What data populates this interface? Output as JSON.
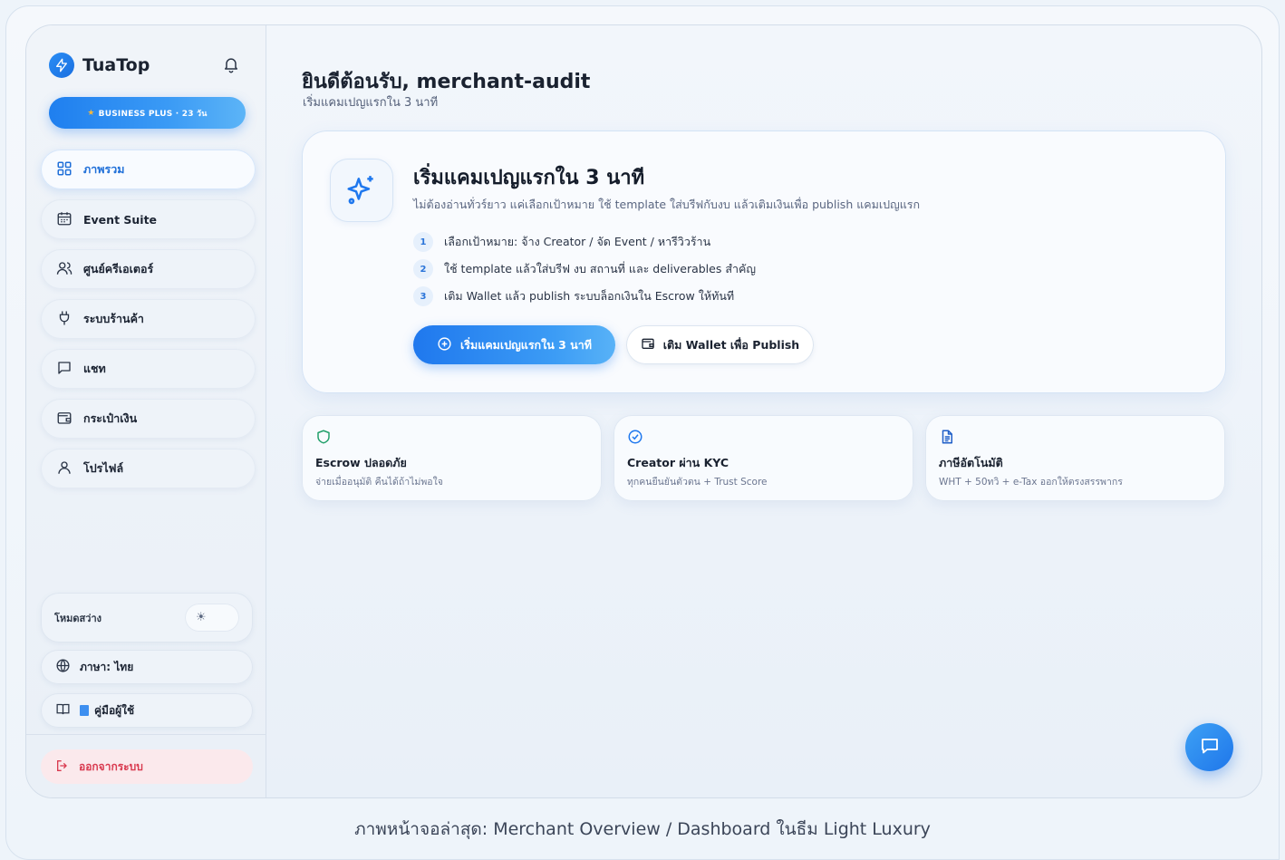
{
  "brand": {
    "name": "TuaTop"
  },
  "plan_badge": {
    "label": "BUSINESS PLUS · 23 วัน"
  },
  "nav": {
    "items": [
      {
        "label": "ภาพรวม",
        "icon": "grid-icon",
        "active": true
      },
      {
        "label": "Event Suite",
        "icon": "calendar-icon",
        "active": false
      },
      {
        "label": "ศูนย์ครีเอเตอร์",
        "icon": "users-icon",
        "active": false
      },
      {
        "label": "ระบบร้านค้า",
        "icon": "plug-icon",
        "active": false
      },
      {
        "label": "แชท",
        "icon": "chat-icon",
        "active": false
      },
      {
        "label": "กระเป๋าเงิน",
        "icon": "wallet-icon",
        "active": false
      },
      {
        "label": "โปรไฟล์",
        "icon": "user-icon",
        "active": false
      }
    ]
  },
  "sidebar_bottom": {
    "mode_label": "โหมดสว่าง",
    "mode_icon": "sun-icon",
    "language_label": "ภาษา: ไทย",
    "guide_label": "คู่มือผู้ใช้",
    "logout_label": "ออกจากระบบ"
  },
  "header": {
    "title": "ยินดีต้อนรับ, merchant-audit",
    "subtitle": "เริ่มแคมเปญแรกใน 3 นาที"
  },
  "hero": {
    "title": "เริ่มแคมเปญแรกใน 3 นาที",
    "description": "ไม่ต้องอ่านทั่วร์ยาว แค่เลือกเป้าหมาย ใช้ template ใส่บรีฟกับงบ แล้วเติมเงินเพื่อ publish แคมเปญแรก",
    "steps": [
      {
        "num": "1",
        "text": "เลือกเป้าหมาย: จ้าง Creator / จัด Event / หารีวิวร้าน"
      },
      {
        "num": "2",
        "text": "ใช้ template แล้วใส่บรีฟ งบ สถานที่ และ deliverables สำคัญ"
      },
      {
        "num": "3",
        "text": "เติม Wallet แล้ว publish ระบบล็อกเงินใน Escrow ให้ทันที"
      }
    ],
    "primary_button": "เริ่มแคมเปญแรกใน 3 นาที",
    "secondary_button": "เติม Wallet เพื่อ Publish"
  },
  "features": [
    {
      "title": "Escrow ปลอดภัย",
      "desc": "จ่ายเมื่ออนุมัติ คืนได้ถ้าไม่พอใจ",
      "icon": "shield-icon"
    },
    {
      "title": "Creator ผ่าน KYC",
      "desc": "ทุกคนยืนยันตัวตน + Trust Score",
      "icon": "badge-check-icon"
    },
    {
      "title": "ภาษีอัตโนมัติ",
      "desc": "WHT + 50ทวิ + e-Tax ออกให้ตรงสรรพากร",
      "icon": "document-icon"
    }
  ],
  "caption": "ภาพหน้าจอล่าสุด: Merchant Overview / Dashboard ในธีม Light Luxury",
  "colors": {
    "accent": "#1f78ee",
    "danger": "#d93a4f",
    "text": "#1a2230"
  }
}
